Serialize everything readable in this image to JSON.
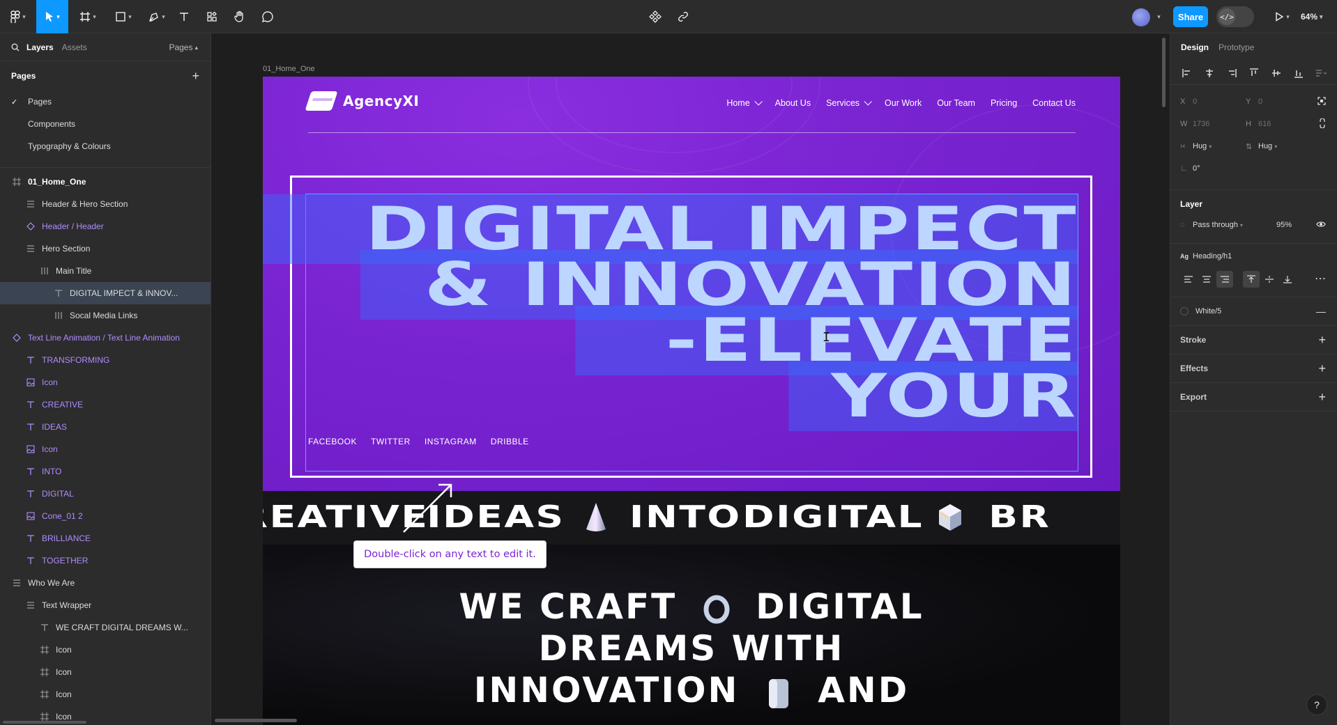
{
  "toolbar": {
    "tools": [
      "main-menu",
      "move",
      "frame",
      "shape",
      "pen",
      "text",
      "resources",
      "hand",
      "comment"
    ],
    "share_label": "Share",
    "zoom_label": "64%",
    "dev_mode_glyph": "</>"
  },
  "left_panel": {
    "tabs": {
      "layers": "Layers",
      "assets": "Assets"
    },
    "pages_toggle": "Pages",
    "pages_header": "Pages",
    "pages": [
      {
        "label": "Pages",
        "current": true
      },
      {
        "label": "Components",
        "current": false
      },
      {
        "label": "Typography & Colours",
        "current": false
      }
    ],
    "layers": [
      {
        "label": "01_Home_One",
        "icon": "frame-icon",
        "depth": 0
      },
      {
        "label": "Header & Hero Section",
        "icon": "autolayout-vertical-icon",
        "depth": 1
      },
      {
        "label": "Header / Header",
        "icon": "instance-icon",
        "depth": 1
      },
      {
        "label": "Hero Section",
        "icon": "autolayout-vertical-icon",
        "depth": 1
      },
      {
        "label": "Main Title",
        "icon": "autolayout-horizontal-icon",
        "depth": 2
      },
      {
        "label": "DIGITAL IMPECT & INNOV...",
        "icon": "text-icon",
        "depth": 3
      },
      {
        "label": "Socal Media Links",
        "icon": "autolayout-horizontal-icon",
        "depth": 3
      },
      {
        "label": "Text Line Animation / Text Line Animation",
        "icon": "instance-icon",
        "depth": 0
      },
      {
        "label": "TRANSFORMING",
        "icon": "text-icon",
        "depth": 1
      },
      {
        "label": "Icon",
        "icon": "image-icon",
        "depth": 1
      },
      {
        "label": "CREATIVE",
        "icon": "text-icon",
        "depth": 1
      },
      {
        "label": "IDEAS",
        "icon": "text-icon",
        "depth": 1
      },
      {
        "label": "Icon",
        "icon": "image-icon",
        "depth": 1
      },
      {
        "label": "INTO",
        "icon": "text-icon",
        "depth": 1
      },
      {
        "label": "DIGITAL",
        "icon": "text-icon",
        "depth": 1
      },
      {
        "label": "Cone_01 2",
        "icon": "image-icon",
        "depth": 1
      },
      {
        "label": "BRILLIANCE",
        "icon": "text-icon",
        "depth": 1
      },
      {
        "label": "TOGETHER",
        "icon": "text-icon",
        "depth": 1
      },
      {
        "label": "Who We Are",
        "icon": "autolayout-vertical-icon",
        "depth": 0
      },
      {
        "label": "Text Wrapper",
        "icon": "autolayout-vertical-icon",
        "depth": 1
      },
      {
        "label": "WE CRAFT DIGITAL DREAMS W...",
        "icon": "text-icon",
        "depth": 2
      },
      {
        "label": "Icon",
        "icon": "frame-icon",
        "depth": 2
      },
      {
        "label": "Icon",
        "icon": "frame-icon",
        "depth": 2
      },
      {
        "label": "Icon",
        "icon": "frame-icon",
        "depth": 2
      },
      {
        "label": "Icon",
        "icon": "frame-icon",
        "depth": 2
      }
    ]
  },
  "canvas": {
    "frame_label": "01_Home_One",
    "logo_text": "AgencyXI",
    "nav": [
      "Home",
      "About Us",
      "Services",
      "Our Work",
      "Our Team",
      "Pricing",
      "Contact Us"
    ],
    "hero_title_lines": [
      "DIGITAL IMPECT",
      "& INNOVATION",
      "-ELEVATE",
      "YOUR"
    ],
    "socials": [
      "FACEBOOK",
      "TWITTER",
      "INSTAGRAM",
      "DRIBBLE"
    ],
    "ticker": [
      "REATIVE",
      "IDEAS",
      "INTO",
      "DIGITAL",
      "BR"
    ],
    "tooltip": "Double-click on any text to edit it.",
    "who_we_are_lines": [
      "WE CRAFT",
      "DIGITAL",
      "DREAMS WITH",
      "INNOVATION",
      "AND"
    ],
    "colors": {
      "hero_purple": "#7a24d2",
      "selection_blue": "#5aa7ff",
      "accent": "#0d99ff"
    }
  },
  "right_panel": {
    "tabs": {
      "design": "Design",
      "prototype": "Prototype"
    },
    "x_label": "X",
    "x_value": "0",
    "y_label": "Y",
    "y_value": "0",
    "w_label": "W",
    "w_value": "1736",
    "h_label": "H",
    "h_value": "616",
    "w_sizing": "Hug",
    "h_sizing": "Hug",
    "rotation": "0°",
    "layer_title": "Layer",
    "blend_mode": "Pass through",
    "opacity": "95%",
    "text_style_glyph": "Ag",
    "text_style": "Heading/h1",
    "fill_name": "White/5",
    "stroke_title": "Stroke",
    "effects_title": "Effects",
    "export_title": "Export",
    "help_glyph": "?"
  }
}
